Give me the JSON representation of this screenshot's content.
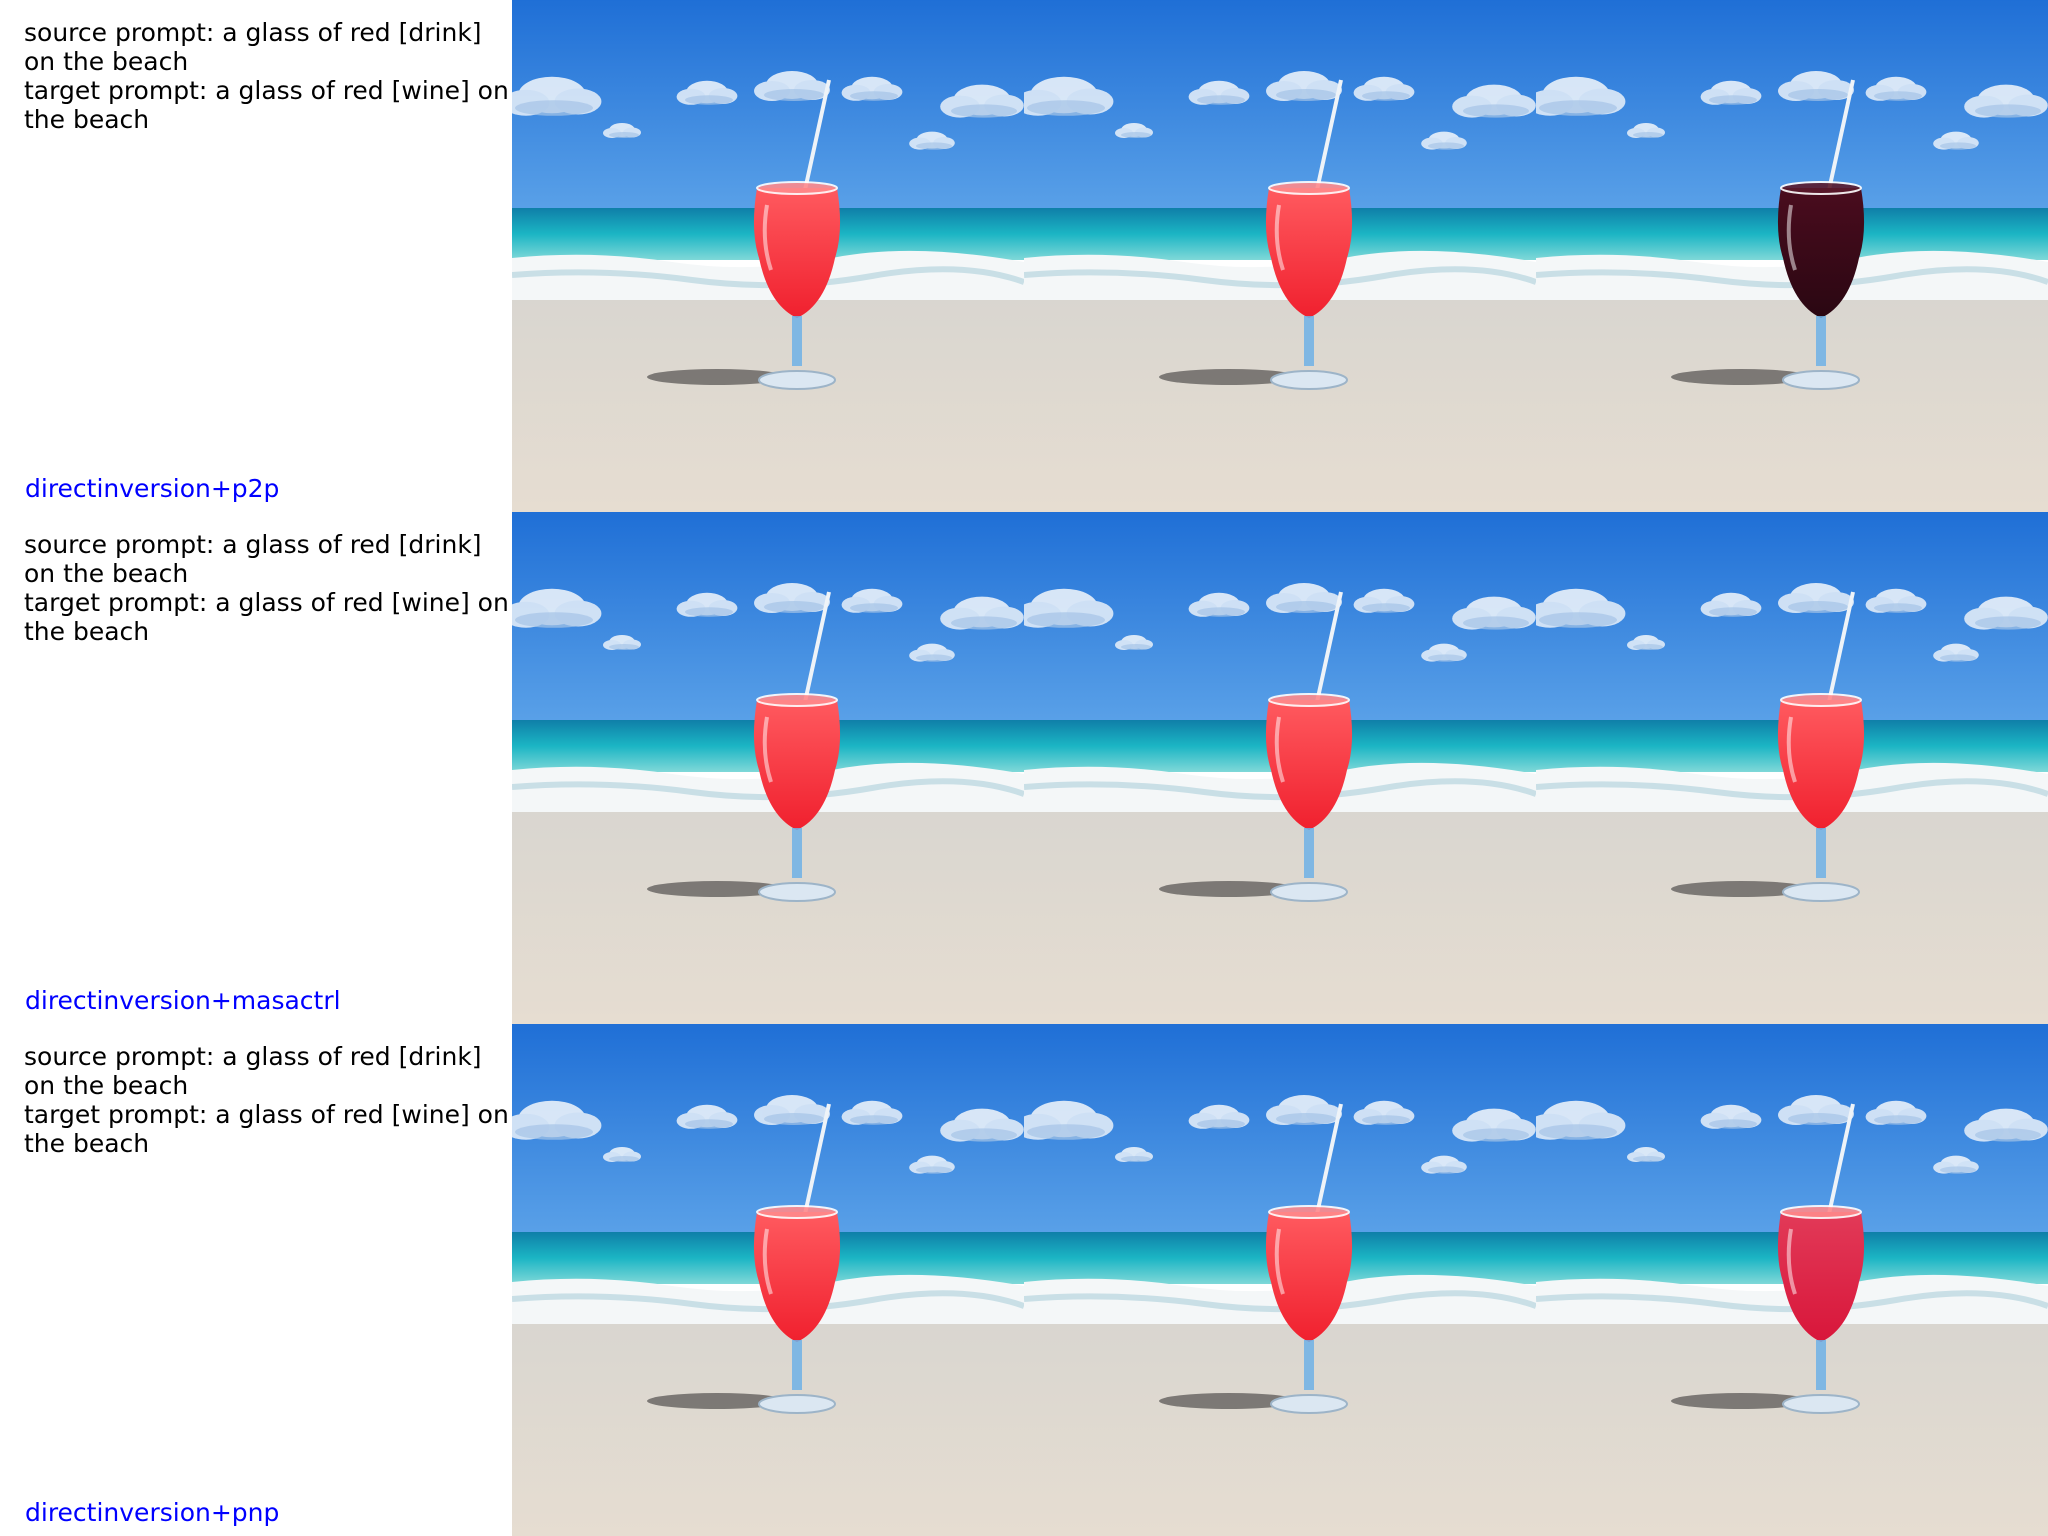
{
  "rows": [
    {
      "prompt_lines": [
        "source prompt: a glass of red [drink]",
        "on the beach",
        "target prompt: a glass of red [wine] on",
        "the beach"
      ],
      "method": "directinversion+p2p",
      "images": [
        {
          "kind": "source"
        },
        {
          "kind": "reconstruction"
        },
        {
          "kind": "edited"
        }
      ]
    },
    {
      "prompt_lines": [
        "source prompt: a glass of red [drink]",
        "on the beach",
        "target prompt: a glass of red [wine] on",
        "the beach"
      ],
      "method": "directinversion+masactrl",
      "images": [
        {
          "kind": "source"
        },
        {
          "kind": "reconstruction"
        },
        {
          "kind": "edited"
        }
      ]
    },
    {
      "prompt_lines": [
        "source prompt: a glass of red [drink]",
        "on the beach",
        "target prompt: a glass of red [wine] on",
        "the beach"
      ],
      "method": "directinversion+pnp",
      "images": [
        {
          "kind": "source"
        },
        {
          "kind": "reconstruction"
        },
        {
          "kind": "edited"
        }
      ]
    }
  ],
  "colors": {
    "method_label": "#0000ff",
    "sky_top": "#1f6fd6",
    "sky_bottom": "#5aa1e8",
    "sea": "#1bb5c4",
    "sand": "#e6ddd1",
    "drink_red": "#f0202e",
    "wine_dark": "#2a0712",
    "wine_red": "#d8163a"
  }
}
